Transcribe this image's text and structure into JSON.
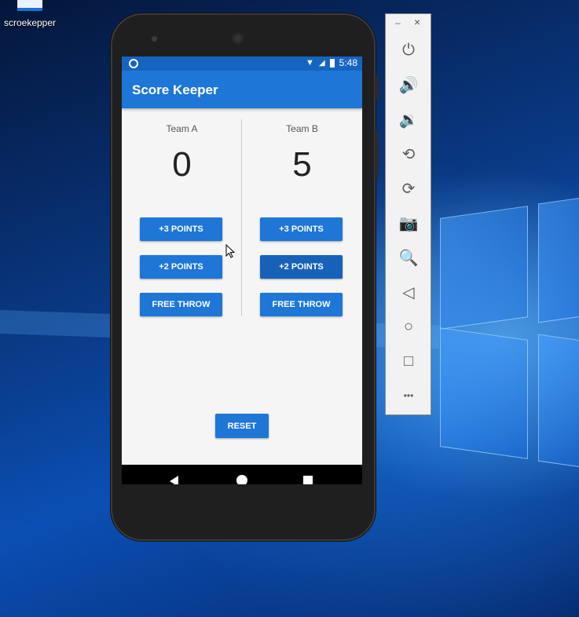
{
  "desktop": {
    "icon_label": "scroekepper"
  },
  "device": {
    "status_bar": {
      "time": "5:48"
    },
    "app": {
      "title": "Score Keeper",
      "team_a": {
        "name": "Team A",
        "score": "0",
        "buttons": [
          "+3 POINTS",
          "+2 POINTS",
          "FREE THROW"
        ]
      },
      "team_b": {
        "name": "Team B",
        "score": "5",
        "buttons": [
          "+3 POINTS",
          "+2 POINTS",
          "FREE THROW"
        ]
      },
      "reset_label": "RESET"
    },
    "nav": {
      "back": "back-icon",
      "home": "home-icon",
      "recents": "recents-icon"
    }
  },
  "emulator_toolbar": {
    "window_controls": {
      "minimize": "–",
      "close": "×"
    },
    "tools": [
      {
        "icon": "power-icon",
        "glyph": "⏻"
      },
      {
        "icon": "volume-up-icon",
        "glyph": "🔊"
      },
      {
        "icon": "volume-down-icon",
        "glyph": "🔉"
      },
      {
        "icon": "rotate-left-icon",
        "glyph": "⟲"
      },
      {
        "icon": "rotate-right-icon",
        "glyph": "⟳"
      },
      {
        "icon": "camera-icon",
        "glyph": "📷"
      },
      {
        "icon": "zoom-icon",
        "glyph": "🔍"
      },
      {
        "icon": "back-icon",
        "glyph": "◁"
      },
      {
        "icon": "home-icon",
        "glyph": "○"
      },
      {
        "icon": "overview-icon",
        "glyph": "□"
      },
      {
        "icon": "more-icon",
        "glyph": "•••"
      }
    ]
  },
  "colors": {
    "primary": "#1e76d6",
    "primary_dark": "#1565c0",
    "background": "#f5f5f5"
  }
}
